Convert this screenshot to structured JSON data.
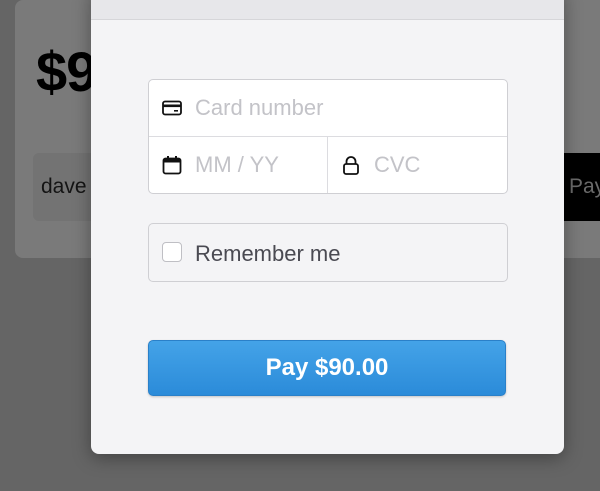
{
  "background": {
    "price": "$9",
    "email": "dave",
    "pay_label": "Pay"
  },
  "form": {
    "card_number_placeholder": "Card number",
    "expiry_placeholder": "MM / YY",
    "cvc_placeholder": "CVC",
    "remember_label": "Remember me",
    "remember_checked": false,
    "pay_button_label": "Pay $90.00"
  },
  "icons": {
    "card": "credit-card-icon",
    "expiry": "calendar-icon",
    "cvc": "lock-icon"
  },
  "colors": {
    "accent": "#2b8bd9",
    "overlay": "#656565",
    "modal_bg": "#f4f4f6"
  }
}
